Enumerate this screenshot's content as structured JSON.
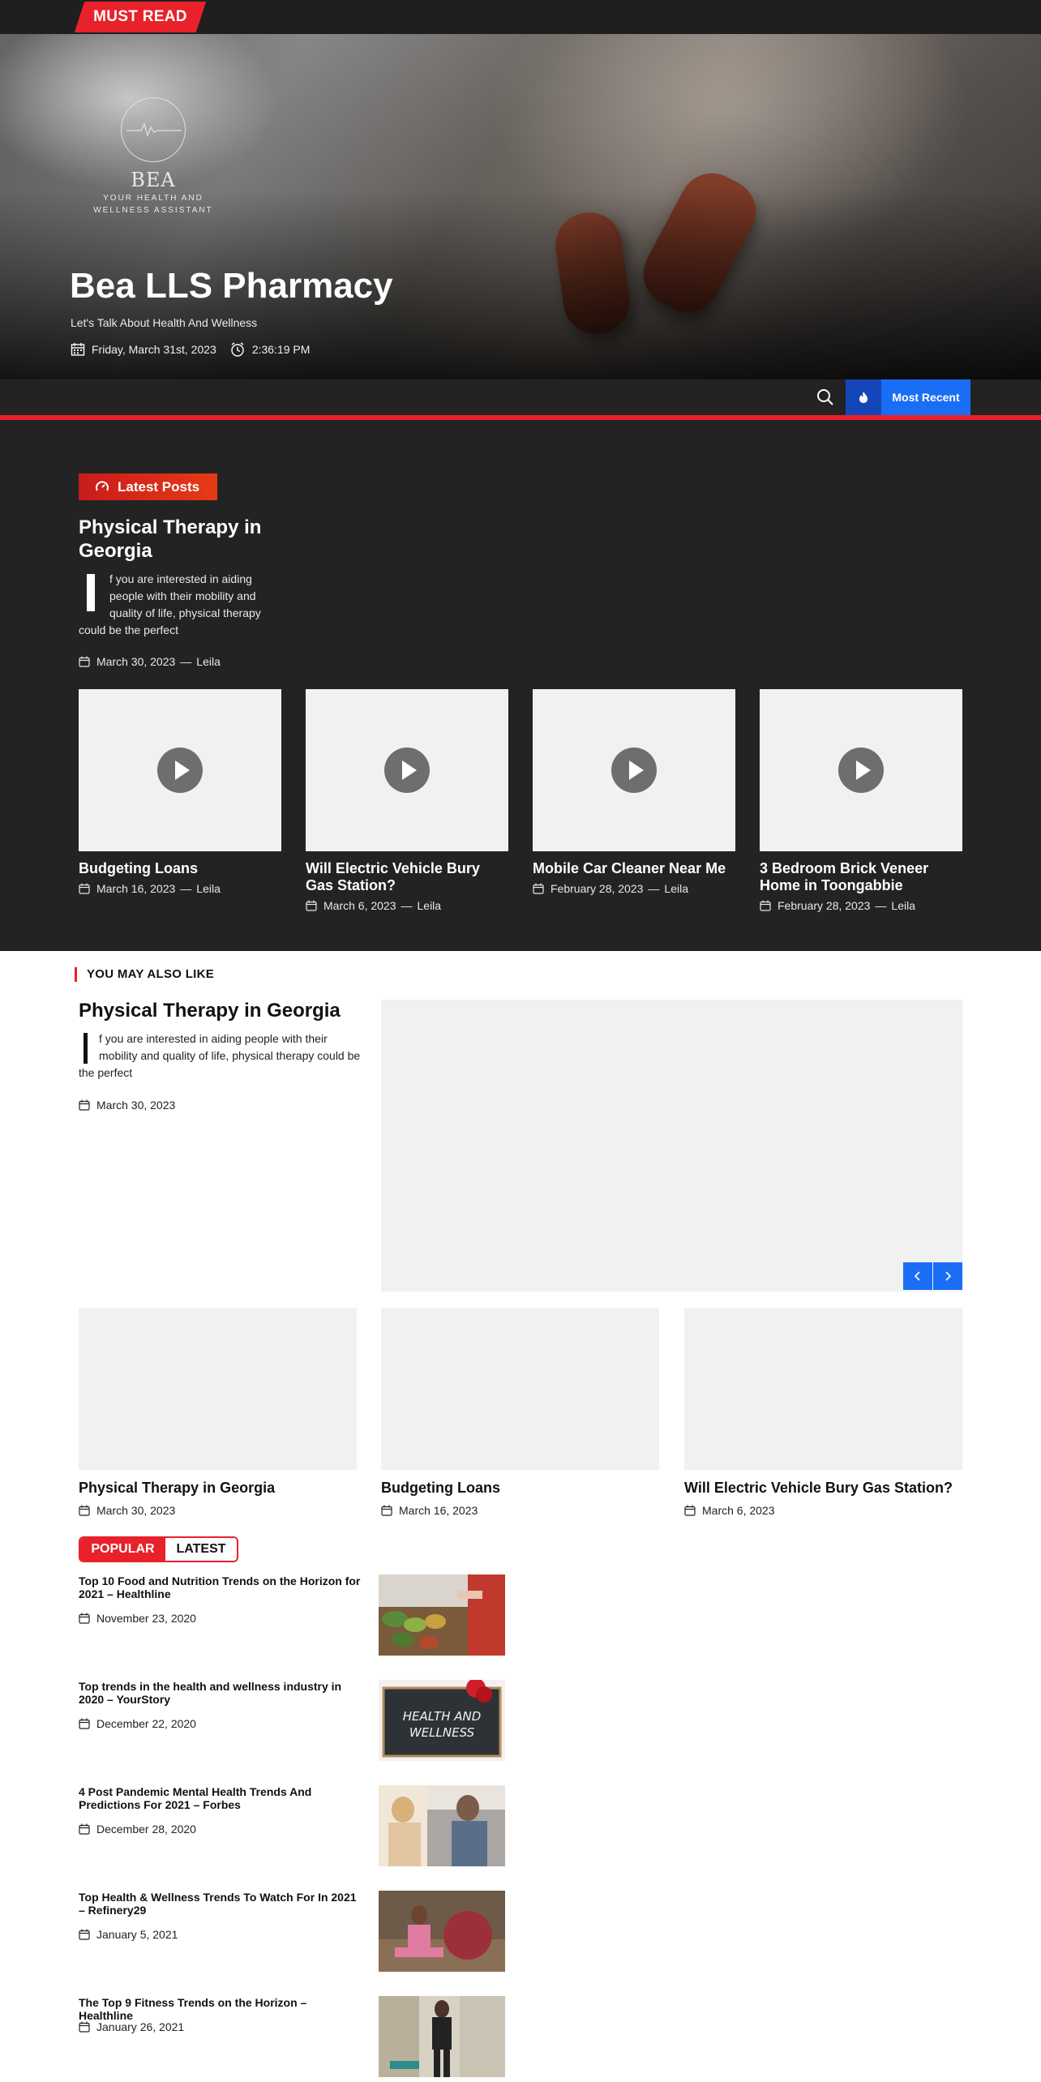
{
  "top_strip": {
    "must_read": "MUST READ"
  },
  "hero": {
    "logo_name": "BEA",
    "logo_tagline_1": "YOUR HEALTH AND",
    "logo_tagline_2": "WELLNESS ASSISTANT",
    "site_title": "Bea LLS Pharmacy",
    "site_description": "Let's Talk About Health And Wellness",
    "date": "Friday, March 31st, 2023",
    "time": "2:36:19 PM"
  },
  "nav": {
    "most_recent": "Most Recent",
    "search_icon": "search-icon",
    "fire_icon": "fire-icon"
  },
  "latest": {
    "badge": "Latest Posts",
    "featured": {
      "title": "Physical Therapy in Georgia",
      "excerpt": "f you are interested in aiding people with their mobility and quality of life, physical therapy could be the perfect",
      "date": "March 30, 2023",
      "author": "Leila"
    },
    "cards": [
      {
        "title": "Budgeting Loans",
        "date": "March 16, 2023",
        "author": "Leila"
      },
      {
        "title": "Will Electric Vehicle Bury Gas Station?",
        "date": "March 6, 2023",
        "author": "Leila"
      },
      {
        "title": "Mobile Car Cleaner Near Me",
        "date": "February 28, 2023",
        "author": "Leila"
      },
      {
        "title": "3 Bedroom Brick Veneer Home in Toongabbie",
        "date": "February 28, 2023",
        "author": "Leila"
      }
    ],
    "separator": "—"
  },
  "you_may_also_like": {
    "heading": "YOU MAY ALSO LIKE",
    "featured": {
      "title": "Physical Therapy in Georgia",
      "excerpt": "f you are interested in aiding people with their mobility and quality of life, physical therapy could be the perfect",
      "date": "March 30, 2023"
    },
    "cards": [
      {
        "title": "Physical Therapy in Georgia",
        "date": "March 30, 2023"
      },
      {
        "title": "Budgeting Loans",
        "date": "March 16, 2023"
      },
      {
        "title": "Will Electric Vehicle Bury Gas Station?",
        "date": "March 6, 2023"
      }
    ]
  },
  "tabs": {
    "popular": "POPULAR",
    "latest": "LATEST"
  },
  "trends": [
    {
      "title": "Top 10 Food and Nutrition Trends on the Horizon for 2021 – Healthline",
      "date": "November 23, 2020"
    },
    {
      "title": "Top trends in the health and wellness industry in 2020 – YourStory",
      "date": "December 22, 2020",
      "image_text_1": "HEALTH AND",
      "image_text_2": "WELLNESS"
    },
    {
      "title": "4 Post Pandemic Mental Health Trends And Predictions For 2021 – Forbes",
      "date": "December 28, 2020"
    },
    {
      "title": "Top Health & Wellness Trends To Watch For In 2021 – Refinery29",
      "date": "January 5, 2021"
    },
    {
      "title": "The Top 9 Fitness Trends on the Horizon – Healthline",
      "date": "January 26, 2021"
    }
  ],
  "colors": {
    "accent_red": "#e8212a",
    "accent_blue": "#1a6ef5",
    "dark_bg": "#232323"
  }
}
